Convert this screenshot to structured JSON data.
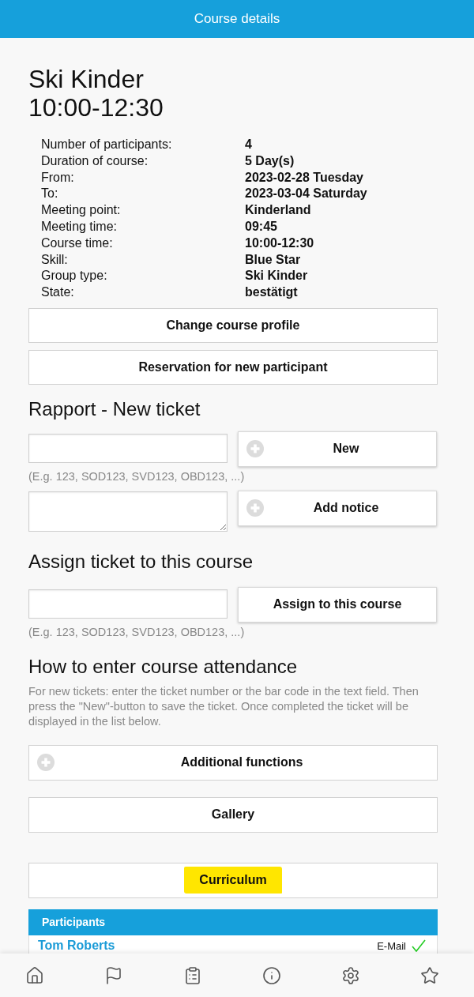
{
  "header": {
    "title": "Course details"
  },
  "course": {
    "title": "Ski Kinder",
    "time": "10:00-12:30",
    "details": [
      {
        "label": "Number of participants:",
        "value": "4"
      },
      {
        "label": "Duration of course:",
        "value": "5 Day(s)"
      },
      {
        "label": "From:",
        "value": "2023-02-28 Tuesday"
      },
      {
        "label": "To:",
        "value": "2023-03-04 Saturday"
      },
      {
        "label": "Meeting point:",
        "value": "Kinderland"
      },
      {
        "label": "Meeting time:",
        "value": "09:45"
      },
      {
        "label": "Course time:",
        "value": "10:00-12:30"
      },
      {
        "label": "Skill:",
        "value": "Blue Star"
      },
      {
        "label": "Group type:",
        "value": "Ski Kinder"
      },
      {
        "label": "State:",
        "value": "bestätigt"
      }
    ]
  },
  "actions": [
    {
      "label": "Change course profile"
    },
    {
      "label": "Reservation for new participant"
    }
  ],
  "rapport": {
    "heading": "Rapport - New ticket",
    "entries": [
      {
        "field": {
          "kind": "input"
        },
        "button": {
          "label": "New",
          "kind": "add"
        },
        "hint": "(E.g. 123, SOD123, SVD123, OBD123, ...)"
      },
      {
        "field": {
          "kind": "textarea"
        },
        "button": {
          "label": "Add notice",
          "kind": "add"
        }
      }
    ]
  },
  "assign": {
    "heading": "Assign ticket to this course",
    "entries": [
      {
        "field": {
          "kind": "input"
        },
        "button": {
          "label": "Assign to this course",
          "kind": "plain"
        },
        "hint": "(E.g. 123, SOD123, SVD123, OBD123, ...)"
      }
    ]
  },
  "attendance": {
    "heading": "How to enter course attendance",
    "text": "For new tickets: enter the ticket number or the bar code in the text field. Then press the \"New\"-button to save the ticket. Once completed the ticket will be displayed in the list below.",
    "button_groups": [
      {
        "buttons": [
          {
            "label": "Additional functions",
            "kind": "add",
            "highlighted": false
          },
          {
            "label": "Gallery",
            "kind": "plain",
            "highlighted": false
          }
        ]
      },
      {
        "buttons": [
          {
            "label": "Curriculum",
            "kind": "plain",
            "highlighted": true
          }
        ]
      }
    ]
  },
  "participants": {
    "title": "Participants",
    "rows": [
      {
        "name": "Tom Roberts",
        "contact": "E-Mail",
        "confirmed": true
      }
    ]
  }
}
